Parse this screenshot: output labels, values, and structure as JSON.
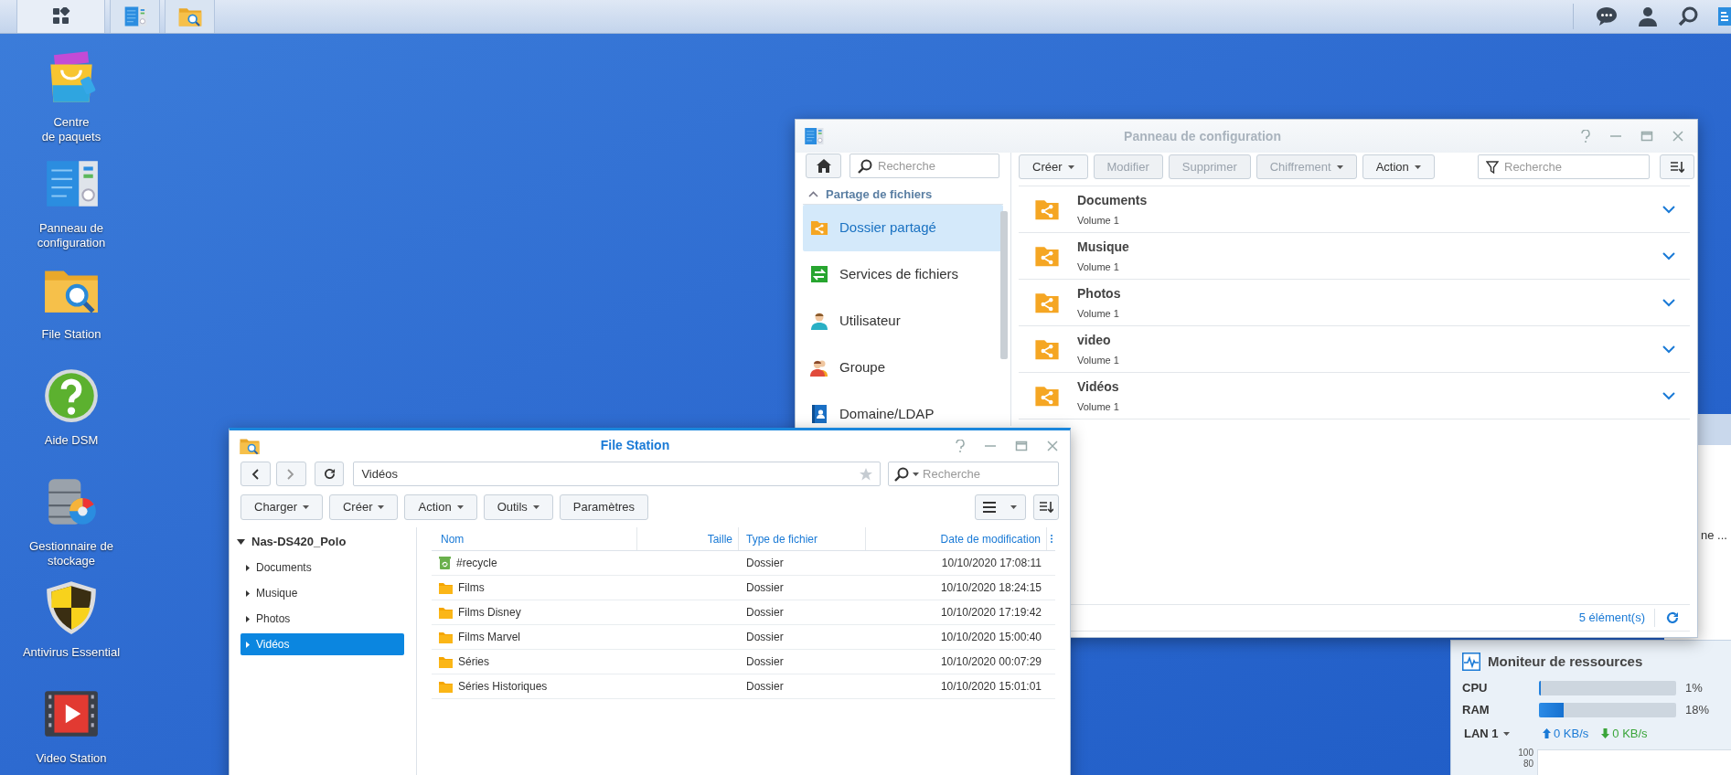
{
  "taskbar": {
    "apps": [
      {
        "kind": "control-panel"
      },
      {
        "kind": "file-station"
      }
    ]
  },
  "desktop_icons": [
    {
      "kind": "package",
      "lines": [
        "Centre",
        "de paquets"
      ]
    },
    {
      "kind": "control-panel",
      "lines": [
        "Panneau de",
        "configuration"
      ]
    },
    {
      "kind": "file-station",
      "lines": [
        "File Station"
      ]
    },
    {
      "kind": "help",
      "lines": [
        "Aide DSM"
      ]
    },
    {
      "kind": "storage",
      "lines": [
        "Gestionnaire de",
        "stockage"
      ]
    },
    {
      "kind": "antivirus",
      "lines": [
        "Antivirus Essential"
      ]
    },
    {
      "kind": "video",
      "lines": [
        "Video Station"
      ]
    }
  ],
  "background_window": {
    "text": "ne ..."
  },
  "control_panel": {
    "title": "Panneau de configuration",
    "search_placeholder": "Recherche",
    "section": {
      "label": "Partage de fichiers",
      "expanded": true
    },
    "items": [
      {
        "kind": "shared-folder",
        "label": "Dossier partagé",
        "selected": true
      },
      {
        "kind": "file-services",
        "label": "Services de fichiers",
        "selected": false
      },
      {
        "kind": "user",
        "label": "Utilisateur",
        "selected": false
      },
      {
        "kind": "group",
        "label": "Groupe",
        "selected": false
      },
      {
        "kind": "domain",
        "label": "Domaine/LDAP",
        "selected": false
      }
    ],
    "toolbar": [
      {
        "label": "Créer",
        "dropdown": true,
        "disabled": false
      },
      {
        "label": "Modifier",
        "dropdown": false,
        "disabled": true
      },
      {
        "label": "Supprimer",
        "dropdown": false,
        "disabled": true
      },
      {
        "label": "Chiffrement",
        "dropdown": true,
        "disabled": true
      },
      {
        "label": "Action",
        "dropdown": true,
        "disabled": false
      }
    ],
    "filter_placeholder": "Recherche",
    "rows": [
      {
        "name": "Documents",
        "volume": "Volume 1"
      },
      {
        "name": "Musique",
        "volume": "Volume 1"
      },
      {
        "name": "Photos",
        "volume": "Volume 1"
      },
      {
        "name": "video",
        "volume": "Volume 1"
      },
      {
        "name": "Vidéos",
        "volume": "Volume 1"
      }
    ],
    "count": "5 élément(s)"
  },
  "file_station": {
    "title": "File Station",
    "path": "Vidéos",
    "search_placeholder": "Recherche",
    "toolbar": [
      {
        "label": "Charger",
        "dropdown": true
      },
      {
        "label": "Créer",
        "dropdown": true
      },
      {
        "label": "Action",
        "dropdown": true
      },
      {
        "label": "Outils",
        "dropdown": true
      },
      {
        "label": "Paramètres",
        "dropdown": false
      }
    ],
    "tree": {
      "label": "Nas-DS420_Polo",
      "expanded": true,
      "children": [
        {
          "label": "Documents",
          "selected": false
        },
        {
          "label": "Musique",
          "selected": false
        },
        {
          "label": "Photos",
          "selected": false
        },
        {
          "label": "Vidéos",
          "selected": true
        }
      ]
    },
    "columns": [
      "Nom",
      "Taille",
      "Type de fichier",
      "Date de modification"
    ],
    "rows": [
      {
        "kind": "recycle",
        "name": "#recycle",
        "type": "Dossier",
        "date": "10/10/2020 17:08:11"
      },
      {
        "kind": "folder",
        "name": "Films",
        "type": "Dossier",
        "date": "10/10/2020 18:24:15"
      },
      {
        "kind": "folder",
        "name": "Films Disney",
        "type": "Dossier",
        "date": "10/10/2020 17:19:42"
      },
      {
        "kind": "folder",
        "name": "Films Marvel",
        "type": "Dossier",
        "date": "10/10/2020 15:00:40"
      },
      {
        "kind": "folder",
        "name": "Séries",
        "type": "Dossier",
        "date": "10/10/2020 00:07:29"
      },
      {
        "kind": "folder",
        "name": "Séries Historiques",
        "type": "Dossier",
        "date": "10/10/2020 15:01:01"
      }
    ]
  },
  "resource_monitor": {
    "title": "Moniteur de ressources",
    "rows": [
      {
        "label": "CPU",
        "level": 0.01,
        "reading": "1%"
      },
      {
        "label": "RAM",
        "level": 0.18,
        "reading": "18%"
      }
    ],
    "network": {
      "label": "LAN 1",
      "upload": "0 KB/s",
      "download": "0 KB/s"
    },
    "chart_labels": [
      "100",
      "80"
    ]
  }
}
